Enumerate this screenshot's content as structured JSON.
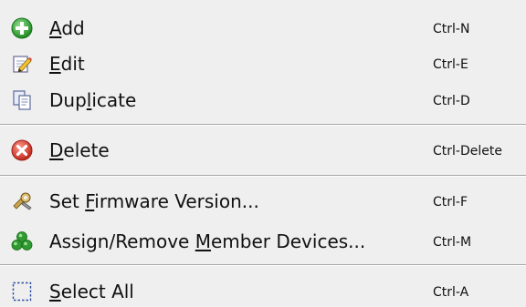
{
  "menu": {
    "items": [
      {
        "pre": "",
        "mnemonic": "A",
        "post": "dd",
        "shortcut": "Ctrl-N",
        "icon": "add-icon"
      },
      {
        "pre": "",
        "mnemonic": "E",
        "post": "dit",
        "shortcut": "Ctrl-E",
        "icon": "edit-icon"
      },
      {
        "pre": "Dup",
        "mnemonic": "l",
        "post": "icate",
        "shortcut": "Ctrl-D",
        "icon": "duplicate-icon"
      },
      {
        "pre": "",
        "mnemonic": "D",
        "post": "elete",
        "shortcut": "Ctrl-Delete",
        "icon": "delete-icon"
      },
      {
        "pre": "Set ",
        "mnemonic": "F",
        "post": "irmware Version...",
        "shortcut": "Ctrl-F",
        "icon": "firmware-icon"
      },
      {
        "pre": "Assign/Remove ",
        "mnemonic": "M",
        "post": "ember Devices...",
        "shortcut": "Ctrl-M",
        "icon": "member-devices-icon"
      },
      {
        "pre": "",
        "mnemonic": "S",
        "post": "elect All",
        "shortcut": "Ctrl-A",
        "icon": "select-all-icon"
      }
    ]
  },
  "colors": {
    "background": "#efefef",
    "separator": "#a8a8a8",
    "add_green": "#2ea12e",
    "delete_red": "#d93a2a"
  }
}
